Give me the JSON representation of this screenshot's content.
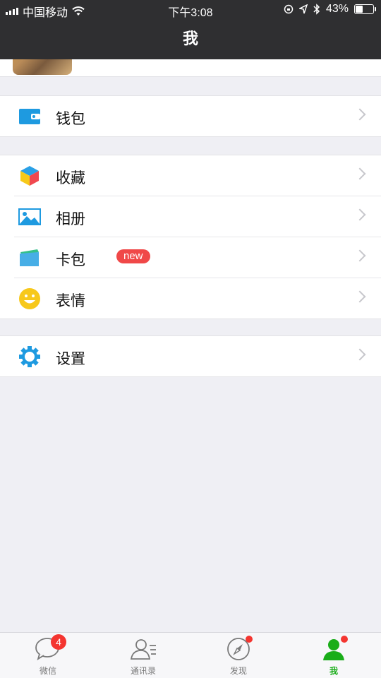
{
  "status_bar": {
    "carrier": "中国移动",
    "time": "下午3:08",
    "battery_percent": "43%"
  },
  "nav": {
    "title": "我"
  },
  "menu": {
    "wallet": {
      "label": "钱包",
      "icon": "wallet-icon"
    },
    "favorites": {
      "label": "收藏",
      "icon": "cube-icon"
    },
    "album": {
      "label": "相册",
      "icon": "image-icon"
    },
    "cards": {
      "label": "卡包",
      "icon": "card-icon",
      "badge": "new"
    },
    "stickers": {
      "label": "表情",
      "icon": "smiley-icon"
    },
    "settings": {
      "label": "设置",
      "icon": "gear-icon"
    }
  },
  "tabbar": {
    "chats": {
      "label": "微信",
      "badge": "4"
    },
    "contacts": {
      "label": "通讯录"
    },
    "discover": {
      "label": "发现"
    },
    "me": {
      "label": "我"
    }
  },
  "colors": {
    "accent_green": "#1aad19",
    "badge_red": "#f43530",
    "nav_dark": "#2f2f31",
    "wallet_blue": "#1e9ae0"
  }
}
